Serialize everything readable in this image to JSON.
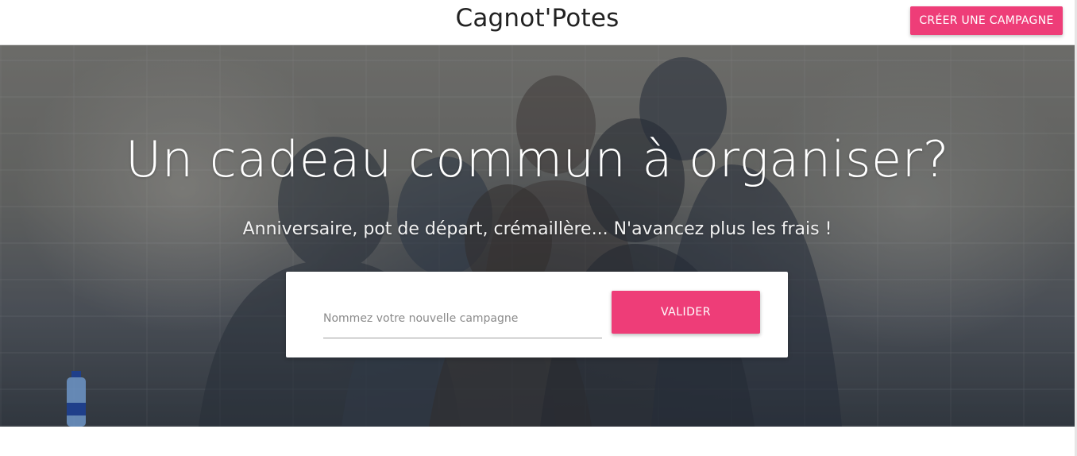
{
  "header": {
    "brand": "Cagnot'Potes",
    "create_button": "CRÉER UNE CAMPAGNE"
  },
  "hero": {
    "title": "Un cadeau commun à organiser?",
    "subtitle": "Anniversaire, pot de départ, crémaillère... N'avancez plus les frais !",
    "form": {
      "input_placeholder": "Nommez votre nouvelle campagne",
      "input_value": "",
      "submit_label": "VALIDER"
    }
  },
  "colors": {
    "accent": "#ee3d78",
    "header_bg": "#ffffff",
    "hero_text": "#ffffff"
  }
}
